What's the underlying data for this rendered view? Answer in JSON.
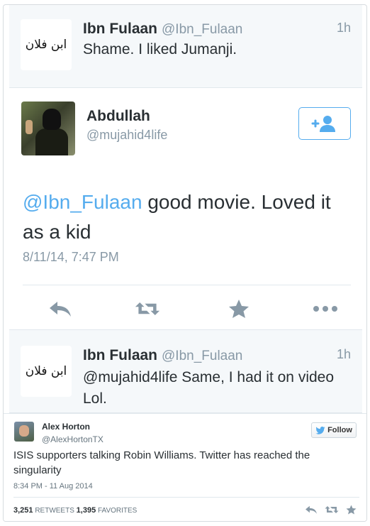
{
  "reply_top": {
    "name": "Ibn Fulaan",
    "handle": "@Ibn_Fulaan",
    "time": "1h",
    "avatar_text": "ابن فلان",
    "text": "Shame. I liked Jumanji."
  },
  "main_tweet": {
    "name": "Abdullah",
    "handle": "@mujahid4life",
    "mention": "@Ibn_Fulaan",
    "text": " good movie. Loved it as a kid",
    "date": "8/11/14, 7:47 PM",
    "actions": [
      "reply-icon",
      "retweet-icon",
      "favorite-icon",
      "more-icon"
    ],
    "follow_icon": "add-user-icon"
  },
  "reply_bottom": {
    "name": "Ibn Fulaan",
    "handle": "@Ibn_Fulaan",
    "time": "1h",
    "avatar_text": "ابن فلان",
    "text": "@mujahid4life Same, I had it on video Lol."
  },
  "embed": {
    "name": "Alex Horton",
    "handle": "@AlexHortonTX",
    "follow_label": "Follow",
    "text": "ISIS supporters talking Robin Williams. Twitter has reached the singularity",
    "timestamp": "8:34 PM - 11 Aug 2014",
    "retweets": "3,251",
    "retweets_label": "RETWEETS",
    "favorites": "1,395",
    "favorites_label": "FAVORITES"
  },
  "colors": {
    "twitter_blue": "#55acee",
    "muted_gray": "#8899a6",
    "reply_bg": "#f5f8fa",
    "text": "#292f33"
  }
}
